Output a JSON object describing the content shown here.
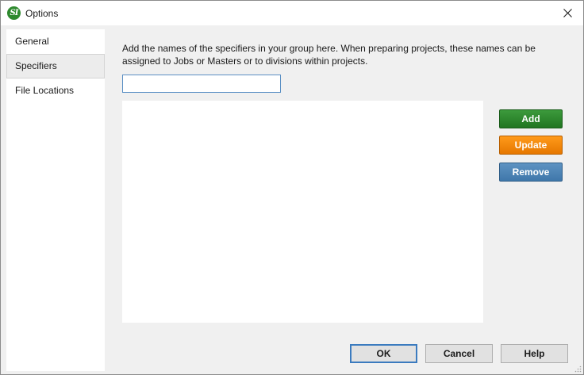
{
  "window": {
    "title": "Options",
    "logo_text": "SI"
  },
  "sidebar": {
    "items": [
      {
        "label": "General",
        "selected": false
      },
      {
        "label": "Specifiers",
        "selected": true
      },
      {
        "label": "File Locations",
        "selected": false
      }
    ]
  },
  "main": {
    "description_line1": "Add the names of the specifiers in your group here.  When preparing projects, these names can be",
    "description_line2": "assigned to Jobs or Masters or to divisions within projects.",
    "input_value": "",
    "list_items": []
  },
  "actions": {
    "add_label": "Add",
    "update_label": "Update",
    "remove_label": "Remove"
  },
  "footer": {
    "ok_label": "OK",
    "cancel_label": "Cancel",
    "help_label": "Help"
  },
  "icons": {
    "close": "close-icon",
    "logo": "app-logo-icon",
    "resize": "resize-grip-icon"
  },
  "colors": {
    "add": "#2a852a",
    "update": "#f08300",
    "remove": "#4a82b6",
    "input_border": "#5a8fc4"
  }
}
